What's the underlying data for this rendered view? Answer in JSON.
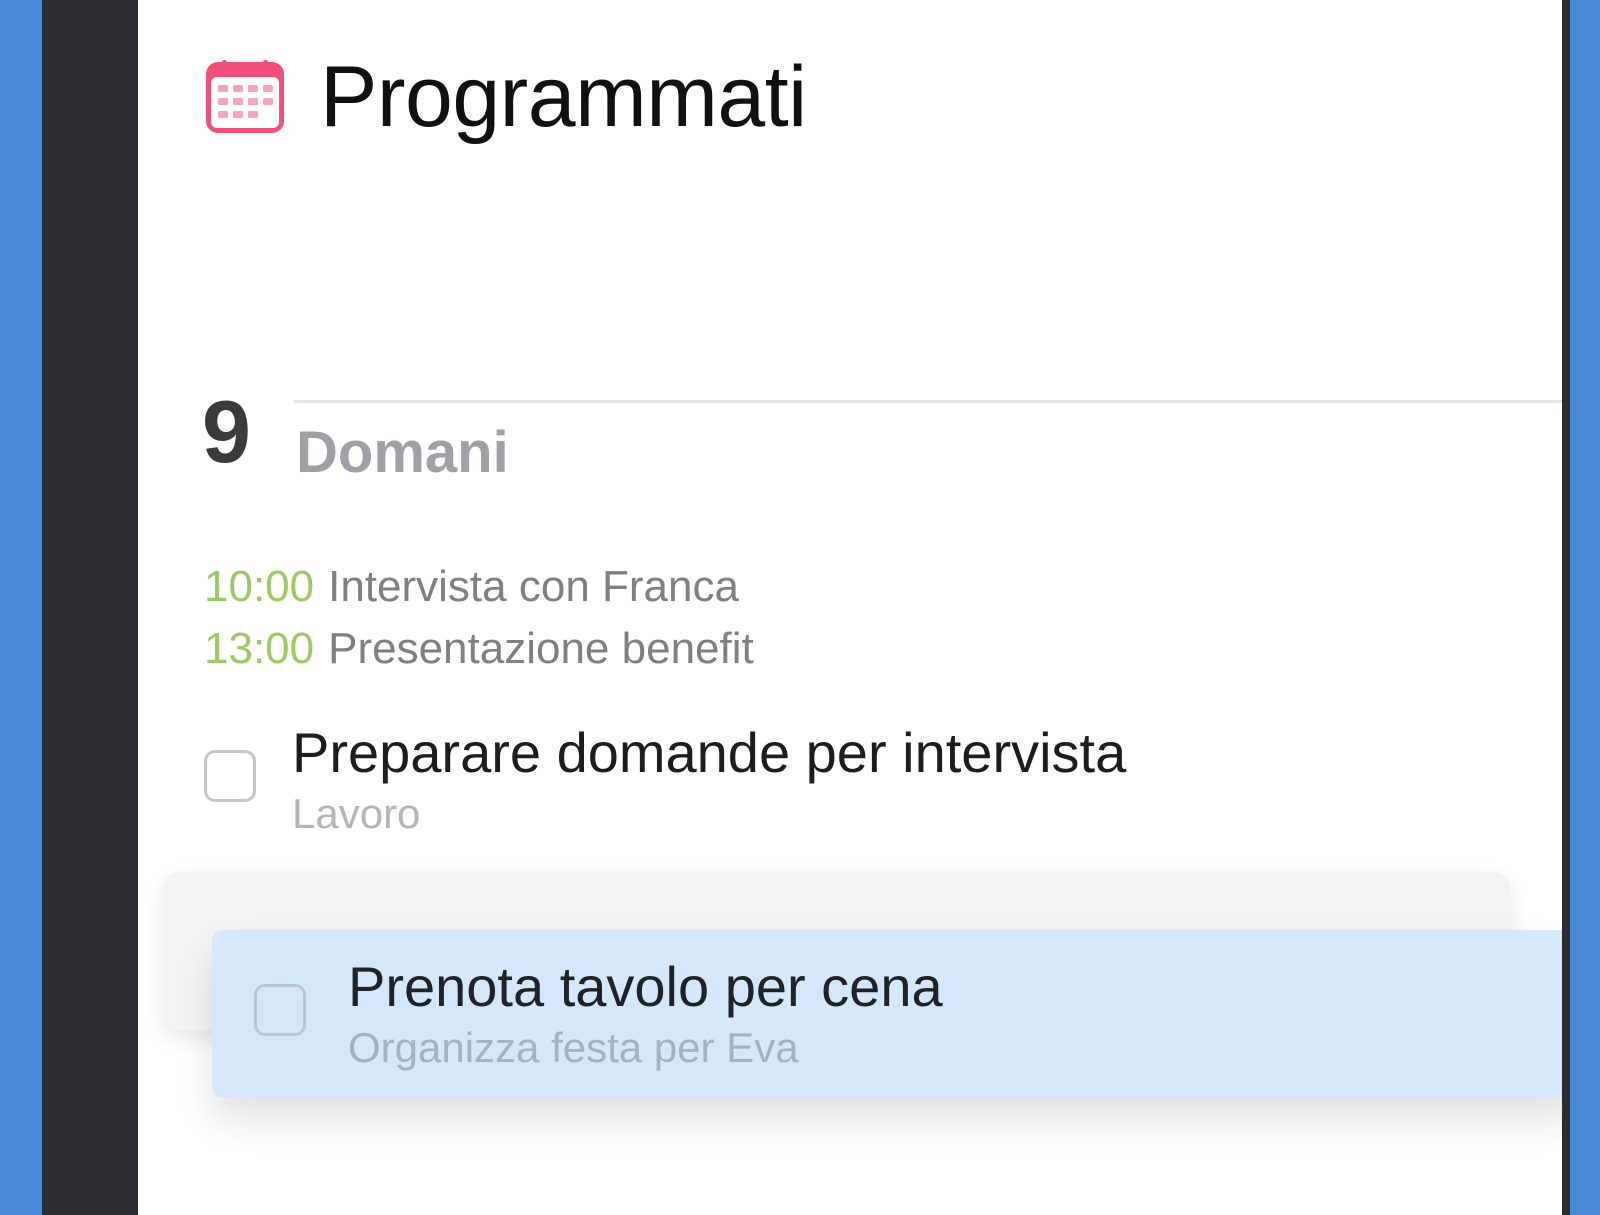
{
  "header": {
    "icon": "calendar-icon",
    "title": "Programmati"
  },
  "day_section": {
    "day_number": "9",
    "day_label": "Domani"
  },
  "events": [
    {
      "time": "10:00",
      "title": "Intervista con Franca"
    },
    {
      "time": "13:00",
      "title": "Presentazione benefit"
    }
  ],
  "tasks": [
    {
      "title": "Preparare domande per intervista",
      "subtitle": "Lavoro",
      "checked": false
    }
  ],
  "dragged_task": {
    "title": "Prenota tavolo per cena",
    "subtitle": "Organizza festa per Eva",
    "checked": false
  },
  "colors": {
    "background": "#4a8ad8",
    "frame": "#2c2d30",
    "screen": "#ffffff",
    "calendar_accent": "#ef4f79",
    "event_time": "#9dc963",
    "event_title": "#7f8084",
    "dragged_card": "#d5e8fb"
  }
}
